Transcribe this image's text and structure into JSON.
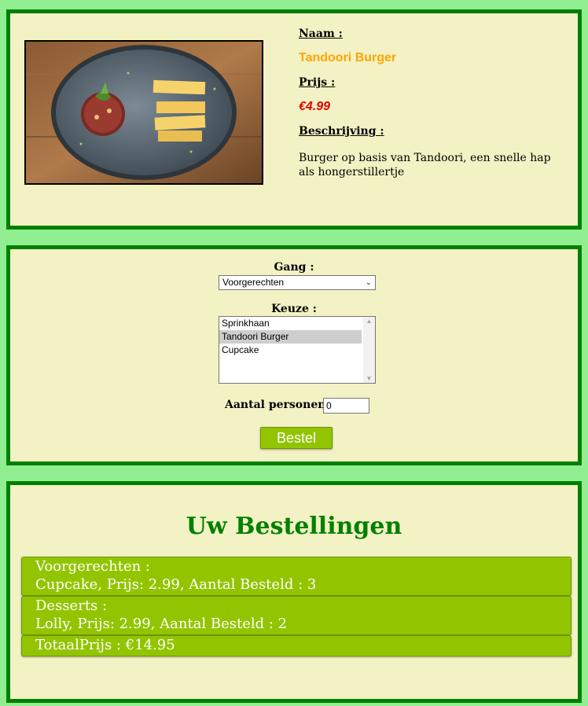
{
  "product": {
    "name_label": "Naam :",
    "name": "Tandoori Burger",
    "price_label": "Prijs :",
    "price": "€4.99",
    "description_label": "Beschrijving :",
    "description": "Burger op basis van Tandoori, een snelle hap als hongerstillertje"
  },
  "order_form": {
    "course_label": "Gang :",
    "course_selected": "Voorgerechten",
    "choice_label": "Keuze :",
    "choices": [
      "Sprinkhaan",
      "Tandoori Burger",
      "Cupcake"
    ],
    "choice_selected": "Tandoori Burger",
    "quantity_label": "Aantal personen :",
    "quantity_value": "0",
    "submit_label": "Bestel"
  },
  "orders": {
    "title": "Uw Bestellingen",
    "items": [
      {
        "course": "Voorgerechten :",
        "detail": "Cupcake, Prijs: 2.99, Aantal Besteld : 3"
      },
      {
        "course": "Desserts :",
        "detail": "Lolly, Prijs: 2.99, Aantal Besteld : 2"
      }
    ],
    "total": "TotaalPrijs : €14.95"
  },
  "colors": {
    "page_background": "#90ee90",
    "panel_background": "#f2f2c4",
    "panel_border": "#008000",
    "accent_button": "#92c500",
    "name_color": "#ffa500",
    "price_color": "#e60000"
  }
}
